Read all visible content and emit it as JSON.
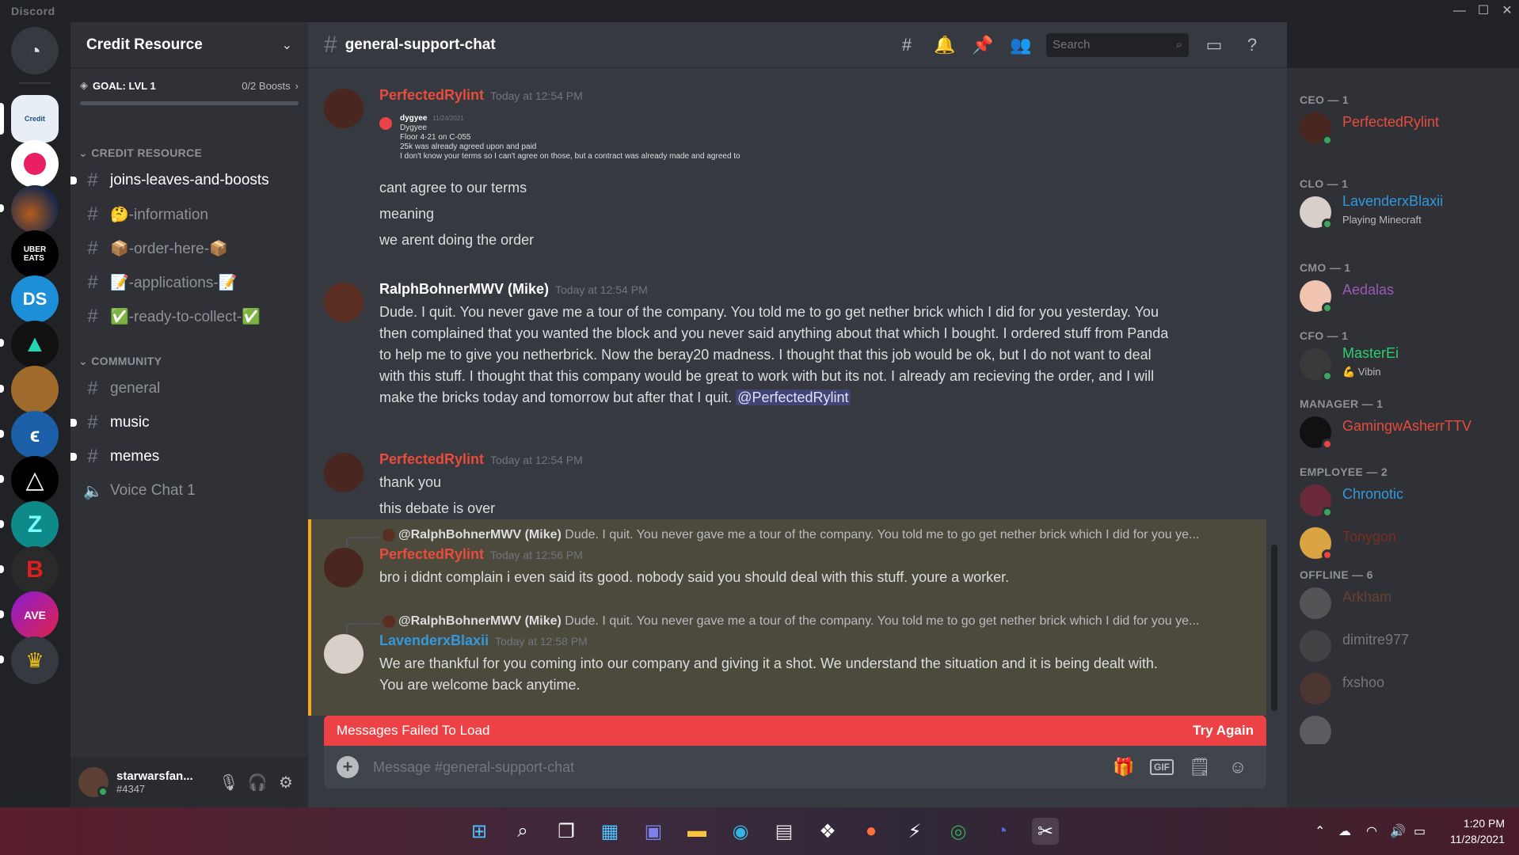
{
  "app": {
    "brand": "Discord"
  },
  "window": {
    "minimize": "—",
    "maximize": "☐",
    "close": "✕"
  },
  "guild": {
    "name": "Credit Resource",
    "goal": "GOAL: LVL 1",
    "boosts": "0/2 Boosts",
    "categories": [
      "CREDIT RESOURCE",
      "COMMUNITY"
    ],
    "channels_cr": [
      {
        "name": "joins-leaves-and-boosts",
        "unread": true
      },
      {
        "name": "🤔-information",
        "unread": false
      },
      {
        "name": "📦-order-here-📦",
        "unread": false
      },
      {
        "name": "📝-applications-📝",
        "unread": false
      },
      {
        "name": "✅-ready-to-collect-✅",
        "unread": false
      }
    ],
    "channels_comm": [
      {
        "name": "general",
        "unread": false
      },
      {
        "name": "music",
        "unread": true
      },
      {
        "name": "memes",
        "unread": true
      },
      {
        "name": "Voice Chat 1",
        "unread": false,
        "voice": true
      }
    ]
  },
  "user": {
    "name": "starwarsfan...",
    "tag": "#4347"
  },
  "channel": {
    "name": "general-support-chat"
  },
  "search": {
    "placeholder": "Search"
  },
  "messages": [
    {
      "author": "PerfectedRylint",
      "time": "Today at 12:54 PM",
      "embed": {
        "author": "dygyee",
        "date": "11/24/2021",
        "lines": [
          "Dygyee",
          "Floor 4-21 on C-055",
          "25k was already agreed upon and paid",
          "I don't know your terms so I can't agree on those, but a contract was already made and agreed to"
        ]
      },
      "lines": [
        "cant agree to our terms",
        "meaning",
        "we arent doing the order"
      ]
    },
    {
      "author": "RalphBohnerMWV (Mike)",
      "time": "Today at 12:54 PM",
      "lines": [
        "Dude. I quit. You never gave me a tour of the company. You told me to go get nether brick which I did for you yesterday. You",
        "then complained that you wanted the block and you never said anything about that which I bought. I ordered stuff from Panda",
        "to help me to give you netherbrick. Now the beray20 madness. I thought that this job would be ok, but I do not want to deal",
        "with this stuff. I thought that this company would be great to work with but its not. I already am recieving the order, and I will",
        "make the bricks today and tomorrow but after that I quit."
      ],
      "mention": "@PerfectedRylint"
    },
    {
      "author": "PerfectedRylint",
      "time": "Today at 12:54 PM",
      "lines": [
        "thank you",
        "this debate is over"
      ]
    },
    {
      "reply_author": "@RalphBohnerMWV (Mike)",
      "reply_text": "Dude. I quit. You never gave me a tour of the company. You told me to go get nether brick which I did for you ye...",
      "author": "PerfectedRylint",
      "time": "Today at 12:56 PM",
      "lines": [
        "bro i didnt complain i even said its good. nobody said you should deal with this stuff. youre a worker."
      ]
    },
    {
      "reply_author": "@RalphBohnerMWV (Mike)",
      "reply_text": "Dude. I quit. You never gave me a tour of the company. You told me to go get nether brick which I did for you ye...",
      "author": "LavenderxBlaxii",
      "time": "Today at 12:58 PM",
      "lines": [
        "We are thankful for you coming into our company and giving it a shot. We understand the situation and it is being dealt with.",
        "You are welcome back anytime."
      ]
    }
  ],
  "fail": {
    "text": "Messages Failed To Load",
    "action": "Try Again"
  },
  "composer": {
    "placeholder": "Message #general-support-chat",
    "gif": "GIF"
  },
  "member_roles": [
    {
      "role": "CEO — 1",
      "members": [
        {
          "name": "PerfectedRylint",
          "color": "#e74c3c",
          "status": "online"
        }
      ]
    },
    {
      "role": "CLO — 1",
      "members": [
        {
          "name": "LavenderxBlaxii",
          "color": "#3498db",
          "status": "online",
          "activity": "Playing Minecraft"
        }
      ]
    },
    {
      "role": "CMO — 1",
      "members": [
        {
          "name": "Aedalas",
          "color": "#9b59b6",
          "status": "online"
        }
      ]
    },
    {
      "role": "CFO — 1",
      "members": [
        {
          "name": "MasterEi",
          "color": "#2ecc71",
          "status": "online",
          "activity": "💪 Vibin"
        }
      ]
    },
    {
      "role": "MANAGER — 1",
      "members": [
        {
          "name": "GamingwAsherrTTV",
          "color": "#e74c3c",
          "status": "dnd"
        }
      ]
    },
    {
      "role": "EMPLOYEE — 2",
      "members": [
        {
          "name": "Chronotic",
          "color": "#3498db",
          "status": "online"
        },
        {
          "name": "Tonygon",
          "color": "#7a2e20",
          "status": "dnd"
        }
      ]
    },
    {
      "role": "OFFLINE — 6",
      "members": [
        {
          "name": "Arkham",
          "color": "#5c4a40",
          "status": ""
        },
        {
          "name": "dimitre977",
          "color": "#4e5d6c",
          "status": ""
        },
        {
          "name": "fxshoo",
          "color": "#4e5d6c",
          "status": ""
        }
      ]
    }
  ],
  "clock": {
    "time": "1:20 PM",
    "date": "11/28/2021"
  }
}
